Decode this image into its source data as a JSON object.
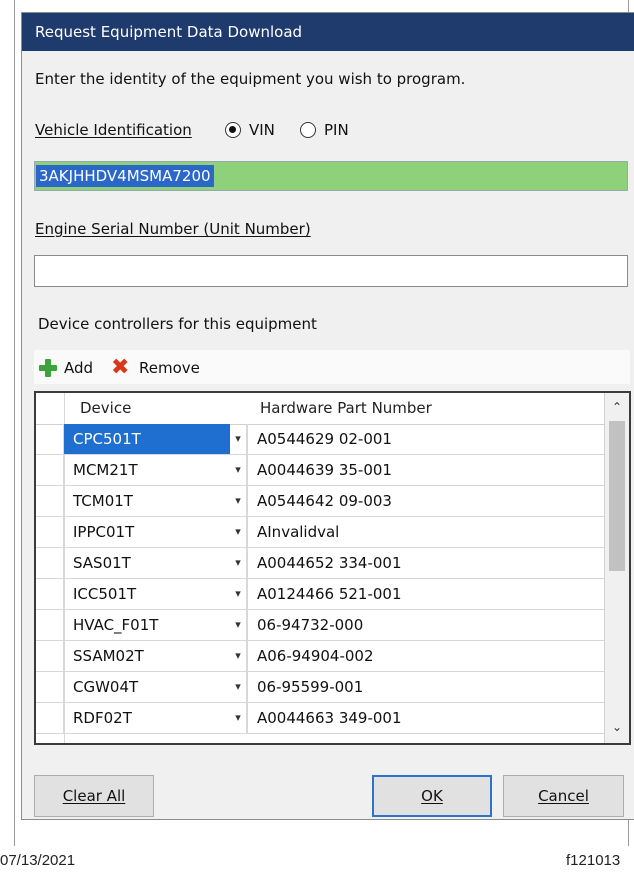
{
  "window": {
    "title": "Request Equipment Data Download"
  },
  "instructions": "Enter the identity of the equipment you wish to program.",
  "vehicle_id": {
    "label": "Vehicle Identification",
    "options": [
      {
        "label": "VIN",
        "selected": true
      },
      {
        "label": "PIN",
        "selected": false
      }
    ],
    "value": "3AKJHHDV4MSMA7200"
  },
  "engine_serial": {
    "label": "Engine Serial Number (Unit Number)",
    "value": ""
  },
  "controllers": {
    "label": "Device controllers for this equipment",
    "add_label": "Add",
    "remove_label": "Remove",
    "columns": [
      "Device",
      "Hardware Part Number"
    ],
    "rows": [
      {
        "device": "CPC501T",
        "part": "A0544629 02-001",
        "selected": true
      },
      {
        "device": "MCM21T",
        "part": "A0044639 35-001"
      },
      {
        "device": "TCM01T",
        "part": "A0544642 09-003"
      },
      {
        "device": "IPPC01T",
        "part": "AInvalidval"
      },
      {
        "device": "SAS01T",
        "part": "A0044652 334-001"
      },
      {
        "device": "ICC501T",
        "part": "A0124466 521-001"
      },
      {
        "device": "HVAC_F01T",
        "part": "06-94732-000"
      },
      {
        "device": "SSAM02T",
        "part": "A06-94904-002"
      },
      {
        "device": "CGW04T",
        "part": "06-95599-001"
      },
      {
        "device": "RDF02T",
        "part": "A0044663 349-001"
      }
    ]
  },
  "buttons": {
    "clear_all": "Clear All",
    "ok": "OK",
    "cancel": "Cancel"
  },
  "footer": {
    "date": "07/13/2021",
    "figure_id": "f121013"
  },
  "colors": {
    "title_bar": "#1f3b6e",
    "vin_field": "#8fd07a",
    "selection": "#1f6fd1"
  },
  "icons": {
    "add": "green-plus-icon",
    "remove": "red-x-icon",
    "dropdown": "dropdown-arrow-icon"
  }
}
